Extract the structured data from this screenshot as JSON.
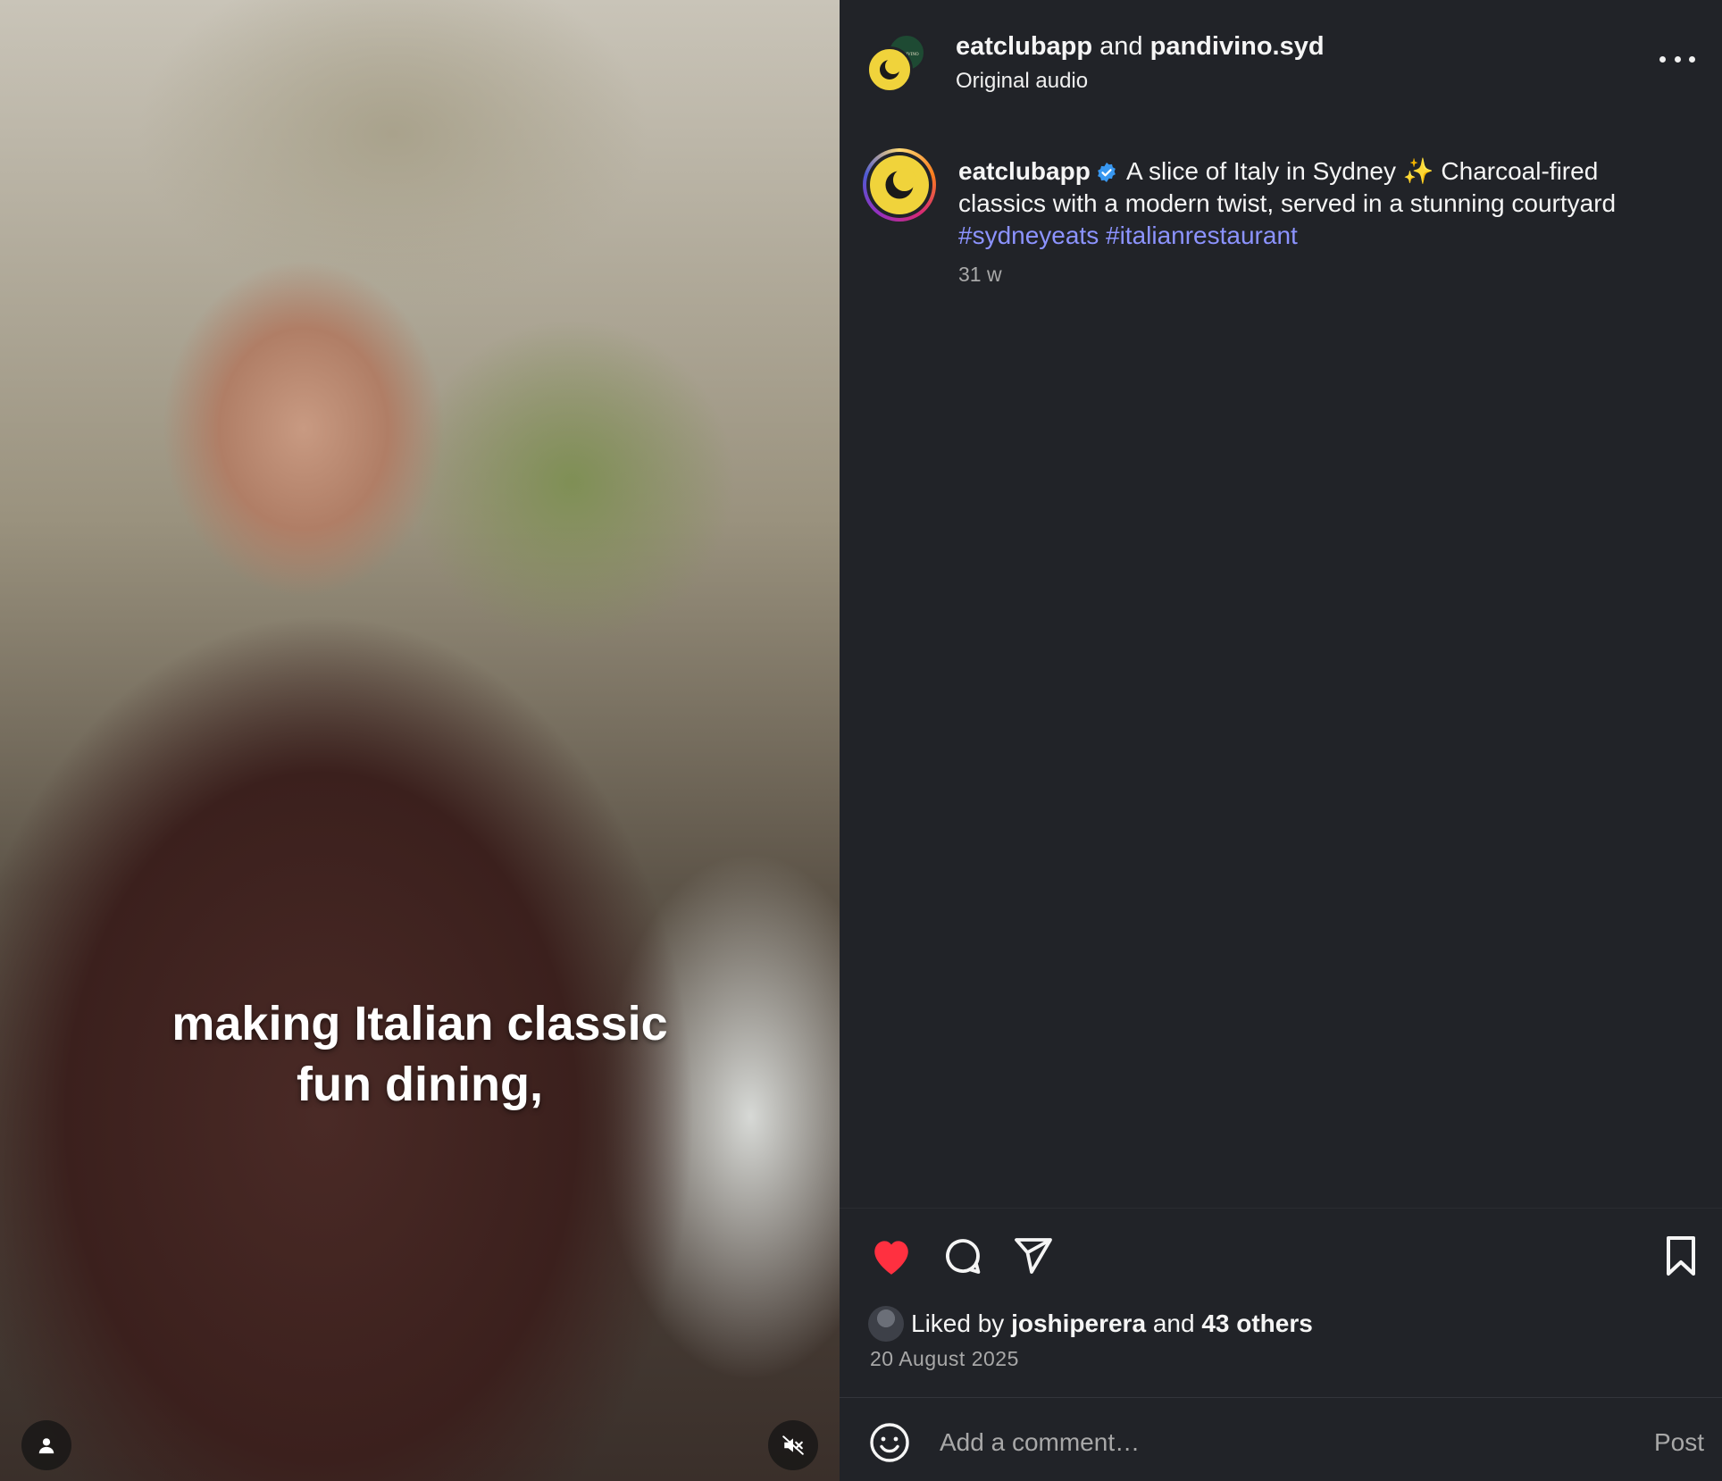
{
  "media": {
    "subtitle_line1": "making Italian classic",
    "subtitle_line2": "fun dining,",
    "user_tag_icon": "person-icon",
    "mute_icon": "speaker-muted-icon"
  },
  "header": {
    "user1": "eatclubapp",
    "joiner": "and",
    "user2": "pandivino.syd",
    "audio": "Original audio",
    "avatar_back_text": "PANDIVINO"
  },
  "caption": {
    "username": "eatclubapp",
    "text_before": "A slice of Italy in Sydney",
    "sparkle": "✨",
    "text_after": "Charcoal-fired classics with a modern twist, served in a stunning courtyard",
    "hashtag1": "#sydneyeats",
    "hashtag2": "#italianrestaurant",
    "time_ago": "31 w"
  },
  "likes": {
    "prefix": "Liked by",
    "liker": "joshiperera",
    "joiner": "and",
    "others": "43 others"
  },
  "post_date": "20 August 2025",
  "comment": {
    "placeholder": "Add a comment…",
    "post_label": "Post"
  },
  "colors": {
    "background": "#212328",
    "accent_link": "#8c93ff",
    "like_red": "#ff3040",
    "brand_yellow": "#f0d33b",
    "verified_blue": "#3897f0"
  }
}
